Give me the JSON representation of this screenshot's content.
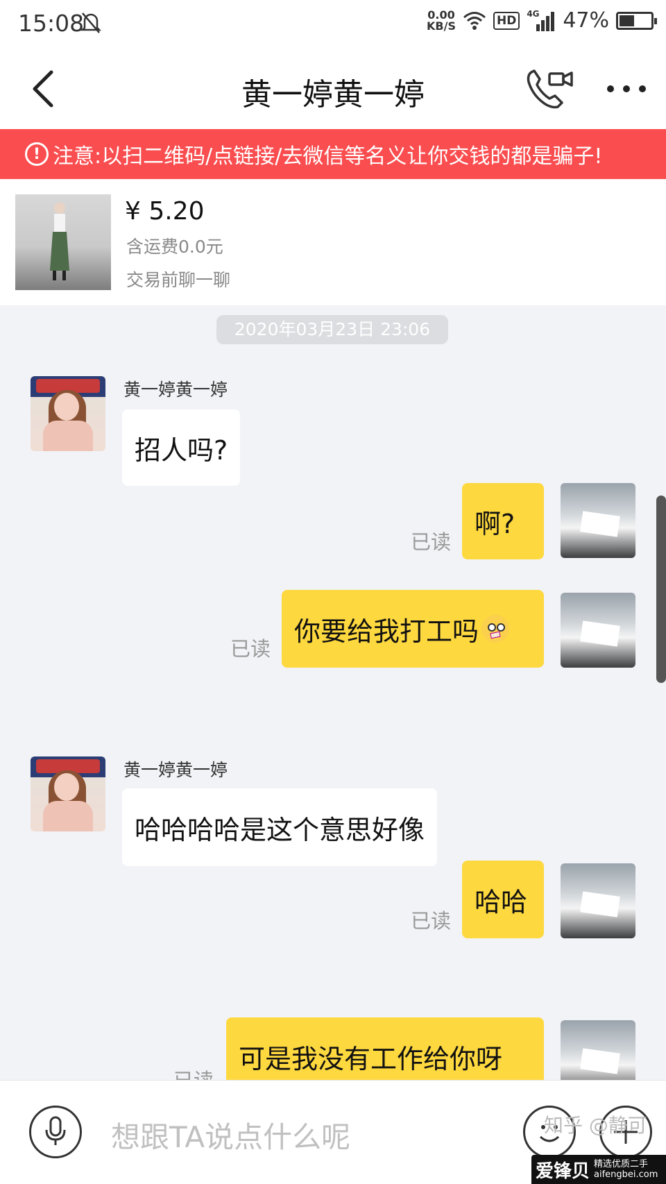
{
  "status_bar": {
    "time": "15:08",
    "net_speed_value": "0.00",
    "net_speed_unit": "KB/S",
    "hd": "HD",
    "network": "4G",
    "battery": "47%",
    "battery_level": 0.47
  },
  "header": {
    "title": "黄一婷黄一婷"
  },
  "warning": {
    "text": "注意:以扫二维码/点链接/去微信等名义让你交钱的都是骗子!"
  },
  "product": {
    "price": "¥ 5.20",
    "shipping": "含运费0.0元",
    "note": "交易前聊一聊"
  },
  "chat": {
    "timestamp": "2020年03月23日 23:06",
    "messages": [
      {
        "side": "left",
        "sender": "黄一婷黄一婷",
        "text": "招人吗?"
      },
      {
        "side": "right",
        "status": "已读",
        "text": "啊?"
      },
      {
        "side": "right",
        "status": "已读",
        "text": "你要给我打工吗"
      },
      {
        "side": "left",
        "sender": "黄一婷黄一婷",
        "text": "哈哈哈哈是这个意思好像"
      },
      {
        "side": "right",
        "status": "已读",
        "text": "哈哈"
      },
      {
        "side": "right",
        "status": "已读",
        "text": "可是我没有工作给你呀"
      }
    ]
  },
  "input_bar": {
    "placeholder": "想跟TA说点什么呢"
  },
  "watermark": {
    "text": "知乎 @静可",
    "brand": "爱锋贝",
    "brand_sub": "精选优质二手",
    "brand_url": "aifengbei.com"
  },
  "colors": {
    "warning_bg": "#fa4d4f",
    "my_bubble": "#fed83f",
    "their_bubble": "#ffffff",
    "chat_bg": "#f2f3f7"
  }
}
